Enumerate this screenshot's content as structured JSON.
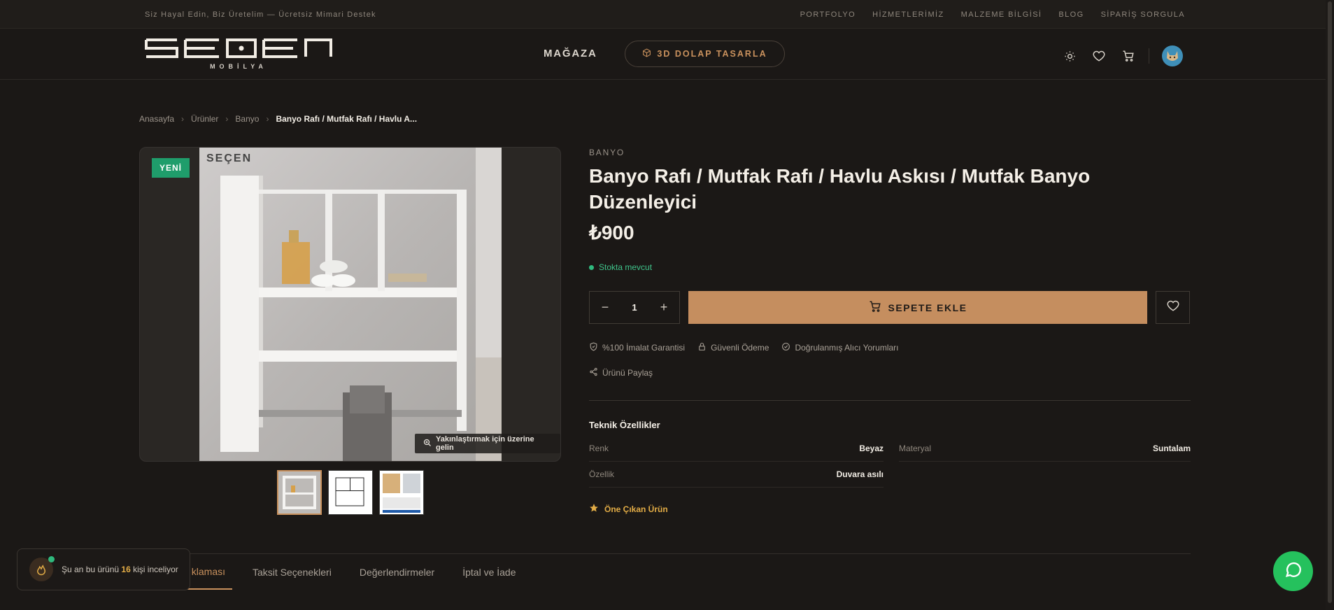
{
  "topbar": {
    "tagline": "Siz Hayal Edin, Biz Üretelim — Ücretsiz Mimari Destek",
    "links": [
      "PORTFOLYO",
      "HİZMETLERİMİZ",
      "MALZEME BİLGİSİ",
      "BLOG",
      "SİPARİŞ SORGULA"
    ]
  },
  "header": {
    "logo_text": "SEÇEN",
    "logo_sub": "M O B İ L Y A",
    "nav_store": "MAĞAZA",
    "design_button": "3D DOLAP TASARLA",
    "icons": [
      "sun-icon",
      "heart-icon",
      "cart-icon",
      "avatar"
    ]
  },
  "breadcrumb": {
    "items": [
      "Anasayfa",
      "Ürünler",
      "Banyo",
      "Banyo Rafı / Mutfak Rafı / Havlu A..."
    ]
  },
  "gallery": {
    "badge": "YENİ",
    "zoom_hint": "Yakınlaştırmak için üzerine gelin",
    "photo_logo": "SEÇEN"
  },
  "product": {
    "category": "BANYO",
    "title": "Banyo Rafı / Mutfak Rafı / Havlu Askısı / Mutfak Banyo Düzenleyici",
    "price": "₺900",
    "stock": "Stokta mevcut",
    "quantity": "1",
    "add_to_cart": "SEPETE EKLE",
    "trust": [
      "%100 İmalat Garantisi",
      "Güvenli Ödeme",
      "Doğrulanmış Alıcı Yorumları"
    ],
    "share": "Ürünü Paylaş",
    "featured": "Öne Çıkan Ürün"
  },
  "specs": {
    "title": "Teknik Özellikler",
    "rows": [
      {
        "key": "Renk",
        "value": "Beyaz"
      },
      {
        "key": "Materyal",
        "value": "Suntalam"
      },
      {
        "key": "Özellik",
        "value": "Duvara asılı"
      }
    ]
  },
  "tabs": [
    "klaması",
    "Taksit Seçenekleri",
    "Değerlendirmeler",
    "İptal ve İade"
  ],
  "viewers": {
    "prefix": "Şu an bu ürünü",
    "count": "16",
    "suffix": "kişi inceliyor"
  },
  "colors": {
    "accent": "#c58e5f",
    "background": "#1b1816",
    "success": "#2fb97d",
    "featured": "#e2ac46",
    "chat": "#25c15d"
  }
}
